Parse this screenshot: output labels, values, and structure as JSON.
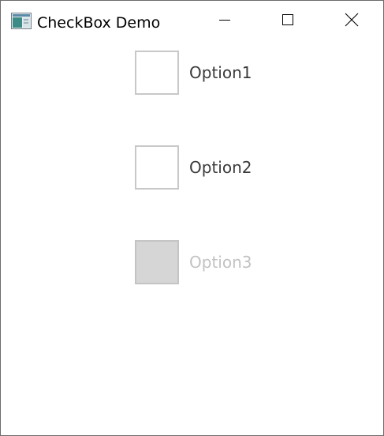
{
  "window": {
    "title": "CheckBox Demo",
    "icon": "app-window-icon",
    "controls": {
      "minimize_icon": "minimize-icon",
      "maximize_icon": "maximize-icon",
      "close_icon": "close-icon"
    }
  },
  "checkboxes": [
    {
      "label": "Option1",
      "checked": false,
      "enabled": true
    },
    {
      "label": "Option2",
      "checked": false,
      "enabled": true
    },
    {
      "label": "Option3",
      "checked": false,
      "enabled": false
    }
  ],
  "colors": {
    "border": "#c8c8c8",
    "disabled_fill": "#d6d6d6",
    "label_text": "#3a3a3a",
    "disabled_text": "#c2c2c2"
  }
}
